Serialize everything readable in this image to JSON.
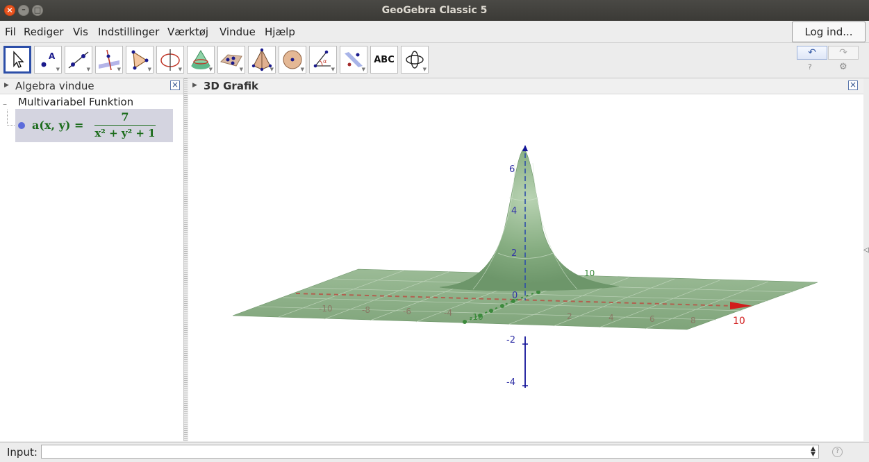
{
  "window": {
    "title": "GeoGebra Classic 5"
  },
  "menu": {
    "items": [
      "Fil",
      "Rediger",
      "Vis",
      "Indstillinger",
      "Værktøj",
      "Vindue",
      "Hjælp"
    ],
    "login_label": "Log ind..."
  },
  "toolbar": {
    "tools": [
      {
        "icon": "move-arrow-icon",
        "active": true
      },
      {
        "icon": "point-icon"
      },
      {
        "icon": "line-icon"
      },
      {
        "icon": "perpendicular-line-icon"
      },
      {
        "icon": "polygon-icon"
      },
      {
        "icon": "circle-axis-icon"
      },
      {
        "icon": "intersect-surfaces-icon"
      },
      {
        "icon": "plane-points-icon"
      },
      {
        "icon": "pyramid-icon"
      },
      {
        "icon": "sphere-icon"
      },
      {
        "icon": "angle-icon"
      },
      {
        "icon": "reflect-plane-icon"
      },
      {
        "icon": "text-icon",
        "label": "ABC"
      },
      {
        "icon": "rotate-view-icon"
      }
    ],
    "undo_icon": "undo-icon",
    "redo_icon": "redo-icon"
  },
  "algebra": {
    "title": "Algebra vindue",
    "group_label": "Multivariabel Funktion",
    "function": {
      "lhs": "a(x, y) =",
      "numerator": "7",
      "denominator": "x² + y² + 1",
      "color": "#1a6b1a",
      "dot_color": "#5c6bdb"
    }
  },
  "graphics3d": {
    "title": "3D Grafik",
    "surface_color": "#7fa87a",
    "z_axis_color": "#1a1aa0",
    "x_axis_color": "#c0392b",
    "y_axis_color": "#2e8b2e",
    "z_tick_labels": [
      "6",
      "4",
      "2",
      "0",
      "-2",
      "-4"
    ],
    "x_tick_labels": [
      "-10",
      "-8",
      "-6",
      "-4",
      "2",
      "4",
      "6",
      "8",
      "10"
    ],
    "y_tick_labels": [
      "-10",
      "10"
    ]
  },
  "input": {
    "label": "Input:",
    "value": ""
  }
}
